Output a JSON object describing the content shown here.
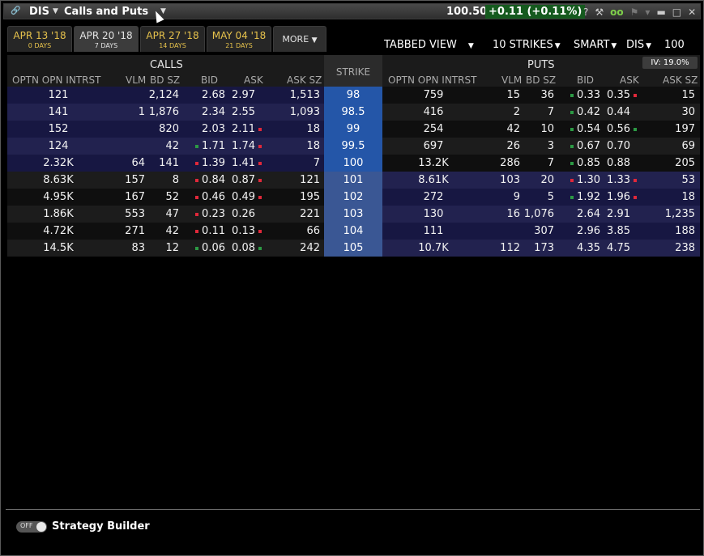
{
  "titlebar": {
    "link_icon": "link-icon",
    "symbol": "DIS",
    "title": "Calls and Puts",
    "price": "100.50",
    "change": "+0.11 (+0.11%)",
    "icons": {
      "help": "?",
      "wrench": "🔧",
      "glasses": "oo",
      "flag": "⚑",
      "caret": "▾",
      "minimize": "▬",
      "maximize": "□",
      "close": "✕"
    },
    "colors": {
      "change_bg": "#155a1e"
    }
  },
  "tabs": [
    {
      "date": "APR 13 '18",
      "days": "0 DAYS",
      "active": false
    },
    {
      "date": "APR 20 '18",
      "days": "7 DAYS",
      "active": true
    },
    {
      "date": "APR 27 '18",
      "days": "14 DAYS",
      "active": false
    },
    {
      "date": "MAY 04 '18",
      "days": "21 DAYS",
      "active": false
    }
  ],
  "more_label": "MORE",
  "toolbar": {
    "view": "TABBED VIEW",
    "strikes": "10 STRIKES",
    "route": "SMART",
    "underlying": "DIS",
    "quantity": "100"
  },
  "headers": {
    "calls": "CALLS",
    "puts": "PUTS",
    "strike": "STRIKE",
    "iv": "IV: 19.0%",
    "columns": [
      "OPTN OPN INTRST",
      "VLM",
      "BD SZ",
      "BID",
      "ASK",
      "ASK SZ"
    ]
  },
  "colors": {
    "strike_itm": "#2456a8",
    "strike_otm": "#3a5794",
    "itm_row_dark": "#171742",
    "itm_row_light": "#22224f",
    "otm_row_dark": "#0f0f0f",
    "otm_row_light": "#1c1c1c",
    "tick_up": "#2c9a44",
    "tick_down": "#e0283a"
  },
  "rows": [
    {
      "strike": "98",
      "calls": {
        "oi": "121",
        "vlm": "",
        "bdsz": "2,124",
        "bid": "2.68",
        "bid_tick": "",
        "ask": "2.97",
        "ask_tick": "",
        "asksz": "1,513"
      },
      "puts": {
        "oi": "759",
        "vlm": "15",
        "bdsz": "36",
        "bid": "0.33",
        "bid_tick": "green",
        "ask": "0.35",
        "ask_tick": "red",
        "asksz": "15"
      }
    },
    {
      "strike": "98.5",
      "calls": {
        "oi": "141",
        "vlm": "1",
        "bdsz": "1,876",
        "bid": "2.34",
        "bid_tick": "",
        "ask": "2.55",
        "ask_tick": "",
        "asksz": "1,093"
      },
      "puts": {
        "oi": "416",
        "vlm": "2",
        "bdsz": "7",
        "bid": "0.42",
        "bid_tick": "green",
        "ask": "0.44",
        "ask_tick": "",
        "asksz": "30"
      }
    },
    {
      "strike": "99",
      "calls": {
        "oi": "152",
        "vlm": "",
        "bdsz": "820",
        "bid": "2.03",
        "bid_tick": "",
        "ask": "2.11",
        "ask_tick": "red",
        "asksz": "18"
      },
      "puts": {
        "oi": "254",
        "vlm": "42",
        "bdsz": "10",
        "bid": "0.54",
        "bid_tick": "green",
        "ask": "0.56",
        "ask_tick": "green",
        "asksz": "197"
      }
    },
    {
      "strike": "99.5",
      "calls": {
        "oi": "124",
        "vlm": "",
        "bdsz": "42",
        "bid": "1.71",
        "bid_tick": "green",
        "ask": "1.74",
        "ask_tick": "red",
        "asksz": "18"
      },
      "puts": {
        "oi": "697",
        "vlm": "26",
        "bdsz": "3",
        "bid": "0.67",
        "bid_tick": "green",
        "ask": "0.70",
        "ask_tick": "",
        "asksz": "69"
      }
    },
    {
      "strike": "100",
      "calls": {
        "oi": "2.32K",
        "vlm": "64",
        "bdsz": "141",
        "bid": "1.39",
        "bid_tick": "red",
        "ask": "1.41",
        "ask_tick": "red",
        "asksz": "7"
      },
      "puts": {
        "oi": "13.2K",
        "vlm": "286",
        "bdsz": "7",
        "bid": "0.85",
        "bid_tick": "green",
        "ask": "0.88",
        "ask_tick": "",
        "asksz": "205"
      }
    },
    {
      "strike": "101",
      "calls": {
        "oi": "8.63K",
        "vlm": "157",
        "bdsz": "8",
        "bid": "0.84",
        "bid_tick": "red",
        "ask": "0.87",
        "ask_tick": "red",
        "asksz": "121"
      },
      "puts": {
        "oi": "8.61K",
        "vlm": "103",
        "bdsz": "20",
        "bid": "1.30",
        "bid_tick": "red",
        "ask": "1.33",
        "ask_tick": "red",
        "asksz": "53"
      }
    },
    {
      "strike": "102",
      "calls": {
        "oi": "4.95K",
        "vlm": "167",
        "bdsz": "52",
        "bid": "0.46",
        "bid_tick": "red",
        "ask": "0.49",
        "ask_tick": "red",
        "asksz": "195"
      },
      "puts": {
        "oi": "272",
        "vlm": "9",
        "bdsz": "5",
        "bid": "1.92",
        "bid_tick": "green",
        "ask": "1.96",
        "ask_tick": "red",
        "asksz": "18"
      }
    },
    {
      "strike": "103",
      "calls": {
        "oi": "1.86K",
        "vlm": "553",
        "bdsz": "47",
        "bid": "0.23",
        "bid_tick": "red",
        "ask": "0.26",
        "ask_tick": "",
        "asksz": "221"
      },
      "puts": {
        "oi": "130",
        "vlm": "16",
        "bdsz": "1,076",
        "bid": "2.64",
        "bid_tick": "",
        "ask": "2.91",
        "ask_tick": "",
        "asksz": "1,235"
      }
    },
    {
      "strike": "104",
      "calls": {
        "oi": "4.72K",
        "vlm": "271",
        "bdsz": "42",
        "bid": "0.11",
        "bid_tick": "red",
        "ask": "0.13",
        "ask_tick": "red",
        "asksz": "66"
      },
      "puts": {
        "oi": "111",
        "vlm": "",
        "bdsz": "307",
        "bid": "2.96",
        "bid_tick": "",
        "ask": "3.85",
        "ask_tick": "",
        "asksz": "188"
      }
    },
    {
      "strike": "105",
      "calls": {
        "oi": "14.5K",
        "vlm": "83",
        "bdsz": "12",
        "bid": "0.06",
        "bid_tick": "green",
        "ask": "0.08",
        "ask_tick": "green",
        "asksz": "242"
      },
      "puts": {
        "oi": "10.7K",
        "vlm": "112",
        "bdsz": "173",
        "bid": "4.35",
        "bid_tick": "",
        "ask": "4.75",
        "ask_tick": "",
        "asksz": "238"
      }
    }
  ],
  "footer": {
    "toggle_state": "OFF",
    "strategy_builder": "Strategy Builder"
  }
}
